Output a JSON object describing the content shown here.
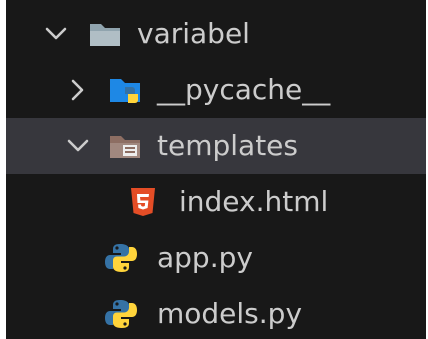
{
  "explorer": {
    "items": [
      {
        "label": "variabel",
        "kind": "folder",
        "expanded": true,
        "icon": "folder-open-icon"
      },
      {
        "label": "__pycache__",
        "kind": "folder",
        "expanded": false,
        "icon": "python-folder-icon"
      },
      {
        "label": "templates",
        "kind": "folder",
        "expanded": true,
        "selected": true,
        "icon": "templates-folder-icon"
      },
      {
        "label": "index.html",
        "kind": "file",
        "icon": "html5-icon"
      },
      {
        "label": "app.py",
        "kind": "file",
        "icon": "python-icon"
      },
      {
        "label": "models.py",
        "kind": "file",
        "icon": "python-icon"
      }
    ]
  },
  "colors": {
    "background": "#181818",
    "selected_row": "#37373d",
    "text": "#cccccc",
    "folder": "#90a4ae",
    "python_blue": "#3572a5",
    "python_yellow": "#ffd43b",
    "html_orange": "#e44d26"
  }
}
